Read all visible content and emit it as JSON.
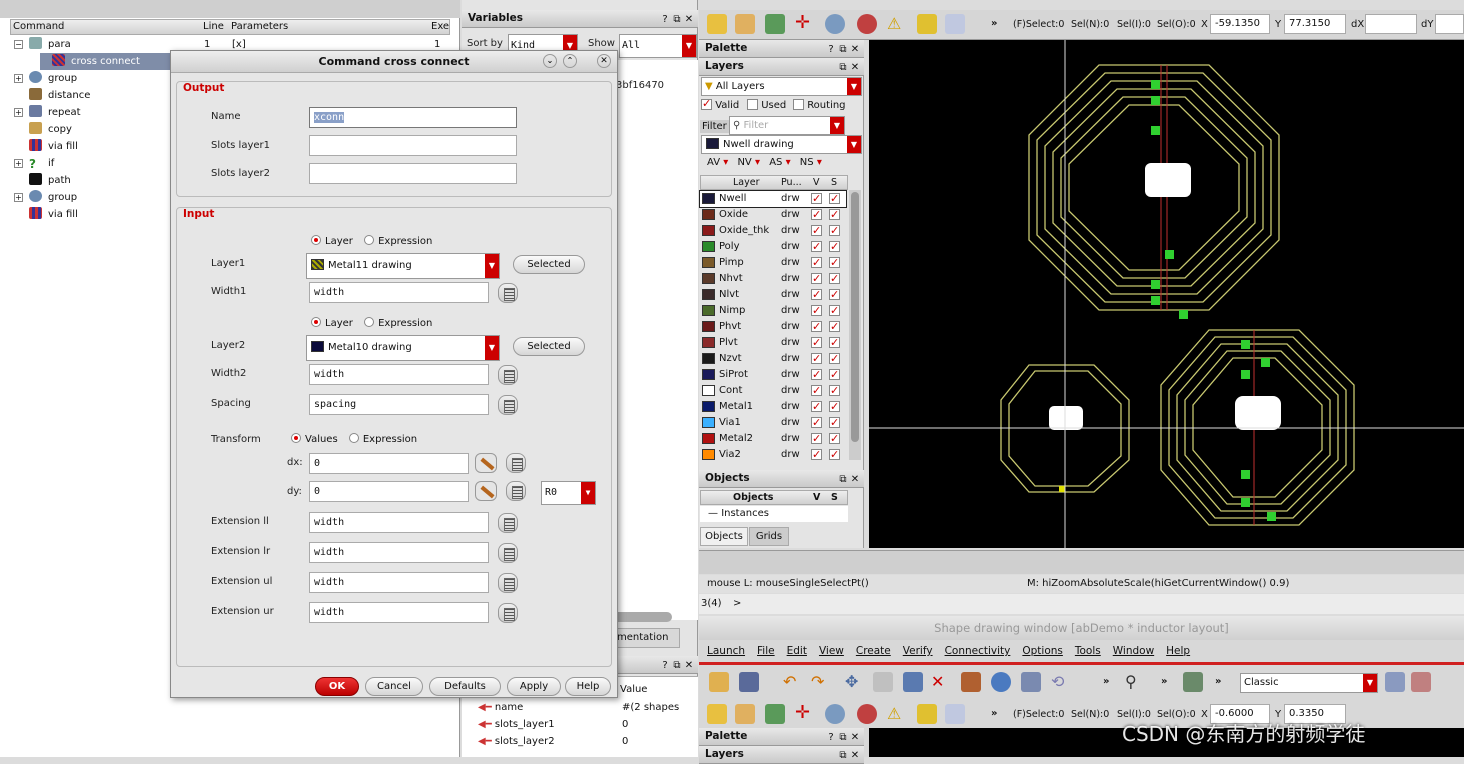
{
  "tree": {
    "headers": [
      "Command",
      "Line",
      "Parameters",
      "Exe"
    ],
    "rows": [
      {
        "label": "para",
        "line": "1",
        "params": "[x]",
        "exe": "1",
        "indent": 0,
        "expand": "-"
      },
      {
        "label": "cross connect",
        "line": "",
        "params": "",
        "exe": "",
        "indent": 1,
        "expand": ""
      },
      {
        "label": "group",
        "indent": 0,
        "expand": "+"
      },
      {
        "label": "distance",
        "indent": 0,
        "expand": ""
      },
      {
        "label": "repeat",
        "indent": 0,
        "expand": "+"
      },
      {
        "label": "copy",
        "indent": 0,
        "expand": ""
      },
      {
        "label": "via fill",
        "indent": 0,
        "expand": ""
      },
      {
        "label": "if",
        "indent": 0,
        "expand": "+"
      },
      {
        "label": "path",
        "indent": 0,
        "expand": ""
      },
      {
        "label": "group",
        "indent": 0,
        "expand": "+"
      },
      {
        "label": "via fill",
        "indent": 0,
        "expand": ""
      }
    ]
  },
  "variables": {
    "title": "Variables",
    "sort_label": "Sort by",
    "sort_value": "Kind",
    "show_label": "Show",
    "show_value": "All",
    "hash_text": "3bf16470",
    "doc_tab": "mentation",
    "bottom_headers": [
      "Value"
    ],
    "bottom_rows": [
      {
        "name": "name",
        "value": "#(2 shapes"
      },
      {
        "name": "slots_layer1",
        "value": "0"
      },
      {
        "name": "slots_layer2",
        "value": "0"
      }
    ]
  },
  "dialog": {
    "title": "Command cross connect",
    "output_section": "Output",
    "name_label": "Name",
    "name_value": "xconn",
    "slots1_label": "Slots layer1",
    "slots2_label": "Slots layer2",
    "input_section": "Input",
    "radio_layer": "Layer",
    "radio_expression": "Expression",
    "layer1_label": "Layer1",
    "layer1_value": "Metal11 drawing",
    "selected_label": "Selected",
    "width1_label": "Width1",
    "width1_value": "width",
    "layer2_label": "Layer2",
    "layer2_value": "Metal10 drawing",
    "width2_label": "Width2",
    "width2_value": "width",
    "spacing_label": "Spacing",
    "spacing_value": "spacing",
    "transform_label": "Transform",
    "radio_values": "Values",
    "dx_label": "dx:",
    "dx_value": "0",
    "dy_label": "dy:",
    "dy_value": "0",
    "rot_value": "R0",
    "ext_ll_label": "Extension ll",
    "ext_lr_label": "Extension lr",
    "ext_ul_label": "Extension ul",
    "ext_ur_label": "Extension ur",
    "ext_value": "width",
    "buttons": {
      "ok": "OK",
      "cancel": "Cancel",
      "defaults": "Defaults",
      "apply": "Apply",
      "help": "Help"
    }
  },
  "toolbar_status": {
    "fselect": "(F)Select:0",
    "seln": "Sel(N):0",
    "seli": "Sel(I):0",
    "selo": "Sel(O):0",
    "x_label": "X",
    "x_value": "-59.1350",
    "y_label": "Y",
    "y_value": "77.3150",
    "dx_label": "dX",
    "dy_label": "dY"
  },
  "palette": {
    "title": "Palette",
    "layers_title": "Layers",
    "all_layers": "All Layers",
    "valid": "Valid",
    "used": "Used",
    "routing": "Routing",
    "filter_label": "Filter",
    "filter_placeholder": "Filter",
    "current_layer": "Nwell drawing",
    "av": "AV",
    "nv": "NV",
    "as": "AS",
    "ns": "NS",
    "col_layer": "Layer",
    "col_pu": "Pu...",
    "col_v": "V",
    "col_s": "S",
    "layers": [
      {
        "name": "Nwell",
        "pu": "drw",
        "color": "#1a1a3a"
      },
      {
        "name": "Oxide",
        "pu": "drw",
        "color": "#6b2a1a"
      },
      {
        "name": "Oxide_thk",
        "pu": "drw",
        "color": "#8a1a1a"
      },
      {
        "name": "Poly",
        "pu": "drw",
        "color": "#2a8a2a"
      },
      {
        "name": "Pimp",
        "pu": "drw",
        "color": "#7a5a2a"
      },
      {
        "name": "Nhvt",
        "pu": "drw",
        "color": "#5a3a2a"
      },
      {
        "name": "Nlvt",
        "pu": "drw",
        "color": "#3a2a2a"
      },
      {
        "name": "Nimp",
        "pu": "drw",
        "color": "#4a6a2a"
      },
      {
        "name": "Phvt",
        "pu": "drw",
        "color": "#6a1a1a"
      },
      {
        "name": "Plvt",
        "pu": "drw",
        "color": "#8a2a2a"
      },
      {
        "name": "Nzvt",
        "pu": "drw",
        "color": "#1a1a1a"
      },
      {
        "name": "SiProt",
        "pu": "drw",
        "color": "#1a1a5a"
      },
      {
        "name": "Cont",
        "pu": "drw",
        "color": "#ffffff"
      },
      {
        "name": "Metal1",
        "pu": "drw",
        "color": "#0a1a6a"
      },
      {
        "name": "Via1",
        "pu": "drw",
        "color": "#3ab0ff"
      },
      {
        "name": "Metal2",
        "pu": "drw",
        "color": "#b01010"
      },
      {
        "name": "Via2",
        "pu": "drw",
        "color": "#ff8a00"
      }
    ]
  },
  "objects": {
    "title": "Objects",
    "col_objects": "Objects",
    "col_v": "V",
    "col_s": "S",
    "instances": "Instances",
    "tab_objects": "Objects",
    "tab_grids": "Grids"
  },
  "status": {
    "mouse": "mouse L: mouseSingleSelectPt()",
    "m_cmd": "M: hiZoomAbsoluteScale(hiGetCurrentWindow() 0.9)",
    "prompt_num": "3(4)",
    "prompt": ">"
  },
  "second_window": {
    "title": "Shape drawing window [abDemo * inductor layout]",
    "menu": [
      "Launch",
      "File",
      "Edit",
      "View",
      "Create",
      "Verify",
      "Connectivity",
      "Options",
      "Tools",
      "Window",
      "Help"
    ],
    "classic": "Classic",
    "fselect": "(F)Select:0",
    "seln": "Sel(N):0",
    "seli": "Sel(I):0",
    "selo": "Sel(O):0",
    "x_value": "-0.6000",
    "y_value": "0.3350",
    "palette": "Palette",
    "layers": "Layers"
  },
  "watermark": "CSDN @东南方的射频学徒"
}
